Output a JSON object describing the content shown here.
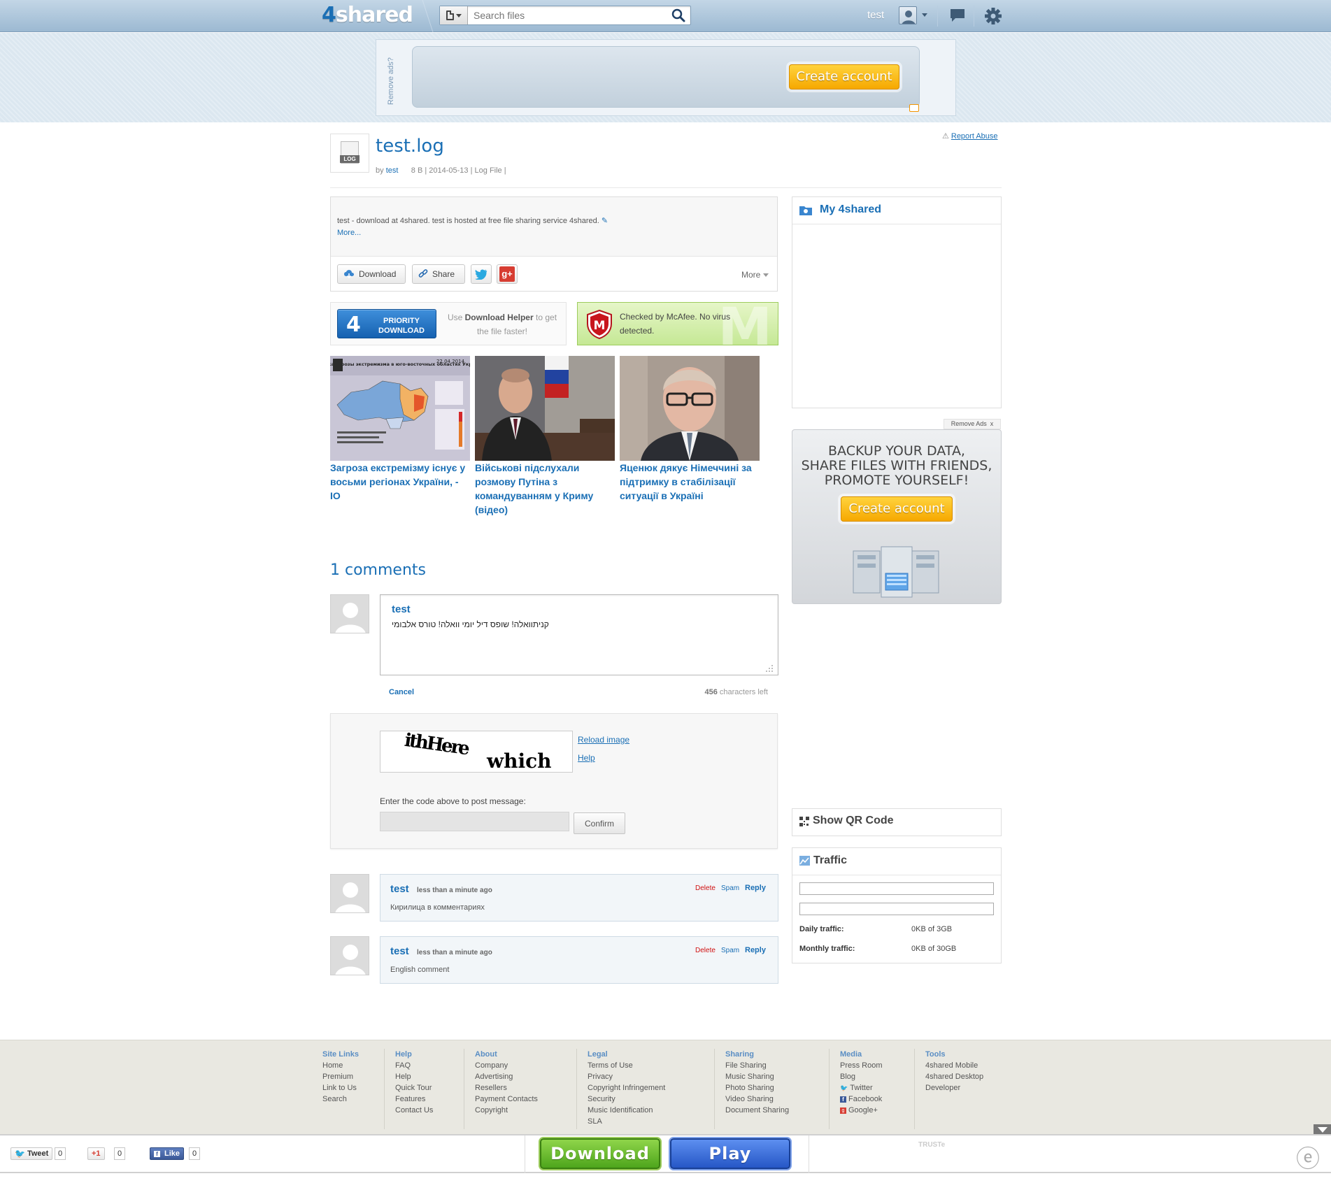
{
  "header": {
    "logo_prefix": "4",
    "logo_text": "shared",
    "search_placeholder": "Search files",
    "username": "test"
  },
  "ad_top": {
    "remove_ads": "Remove ads?",
    "create_account": "Create account"
  },
  "file": {
    "report_abuse": "Report Abuse",
    "icon_label": "LOG",
    "title": "test.log",
    "by": "by",
    "owner": "test",
    "size": "8 B",
    "date": "2014-05-13",
    "type": "Log File",
    "description": "test - download at 4shared. test is hosted at free file sharing service 4shared.",
    "more_link": "More...",
    "actions": {
      "download": "Download",
      "share": "Share",
      "more": "More"
    }
  },
  "priority": {
    "number": "4",
    "label_line1": "PRIORITY",
    "label_line2": "DOWNLOAD",
    "helper_pre": "Use",
    "helper_bold": "Download Helper",
    "helper_post": "to get the file faster!"
  },
  "mcafee": {
    "text": "Checked by McAfee. No virus detected."
  },
  "news": [
    {
      "title": "Загроза екстремізму існує у восьми регіонах України, - ІО",
      "img_caption": "Оценка угрозы экстремизма в юго-восточных областях Украины",
      "img_date": "22.04.2014"
    },
    {
      "title": "Військові підслухали розмову Путіна з командуванням у Криму (відео)"
    },
    {
      "title": "Яценюк дякує Німеччині за підтримку в стабілізації ситуації в Україні"
    }
  ],
  "comments": {
    "heading": "1 comments",
    "editor_author": "test",
    "editor_text": "קניתוואלה! שופס דיל יומי וואלה! טורס אלבומי",
    "cancel": "Cancel",
    "chars_left_count": "456",
    "chars_left_label": "characters left",
    "captcha_word1": "ithHere",
    "captcha_word2": "which",
    "reload_image": "Reload image",
    "help": "Help",
    "code_label": "Enter the code above to post message:",
    "confirm": "Confirm",
    "list": [
      {
        "author": "test",
        "time": "less than a minute ago",
        "text": "Кирилица в комментариях",
        "delete": "Delete",
        "spam": "Spam",
        "reply": "Reply"
      },
      {
        "author": "test",
        "time": "less than a minute ago",
        "text": "English comment",
        "delete": "Delete",
        "spam": "Spam",
        "reply": "Reply"
      }
    ]
  },
  "sidebar": {
    "my4shared": "My 4shared",
    "remove_ads": "Remove Ads",
    "remove_ads_x": "x",
    "ad_line1": "BACKUP YOUR DATA,",
    "ad_line2": "SHARE FILES WITH FRIENDS,",
    "ad_line3": "PROMOTE YOURSELF!",
    "ad_create": "Create account",
    "qr": "Show QR Code",
    "traffic": "Traffic",
    "daily_label": "Daily traffic:",
    "daily_value": "0KB of 3GB",
    "monthly_label": "Monthly traffic:",
    "monthly_value": "0KB of 30GB"
  },
  "footer": {
    "site_links": {
      "head": "Site Links",
      "items": [
        "Home",
        "Premium",
        "Link to Us",
        "Search"
      ]
    },
    "help": {
      "head": "Help",
      "items": [
        "FAQ",
        "Help",
        "Quick Tour",
        "Features",
        "Contact Us"
      ]
    },
    "about": {
      "head": "About",
      "items": [
        "Company",
        "Advertising",
        "Resellers",
        "Payment Contacts",
        "Copyright"
      ]
    },
    "legal": {
      "head": "Legal",
      "items": [
        "Terms of Use",
        "Privacy",
        "Copyright Infringement",
        "Security",
        "Music Identification",
        "SLA"
      ]
    },
    "sharing": {
      "head": "Sharing",
      "items": [
        "File Sharing",
        "Music Sharing",
        "Photo Sharing",
        "Video Sharing",
        "Document Sharing"
      ]
    },
    "media": {
      "head": "Media",
      "items": [
        "Press Room",
        "Blog",
        "Twitter",
        "Facebook",
        "Google+"
      ]
    },
    "tools": {
      "head": "Tools",
      "items": [
        "4shared Mobile",
        "4shared Desktop",
        "Developer"
      ]
    }
  },
  "bottombar": {
    "tweet": "Tweet",
    "tweet_count": "0",
    "gplus": "+1",
    "gplus_count": "0",
    "like": "Like",
    "like_count": "0",
    "download": "Download",
    "play": "Play",
    "truste": "TRUSTe"
  },
  "colors": {
    "brand_blue": "#1a6fb5",
    "orange": "#f6a800",
    "green": "#4ea51c",
    "play_blue": "#2657c6",
    "delete_red": "#d01010"
  }
}
